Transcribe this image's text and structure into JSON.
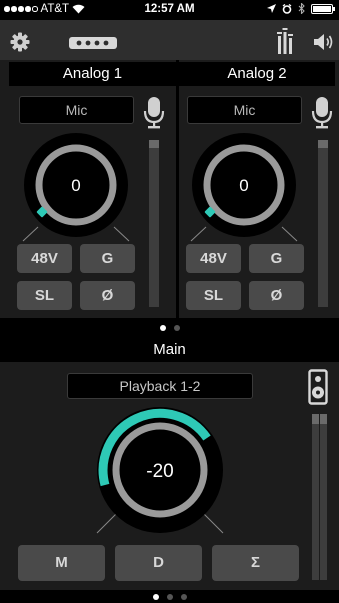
{
  "status_bar": {
    "carrier": "AT&T",
    "time": "12:57 AM"
  },
  "toolbar": {
    "settings_icon": "gear-icon",
    "device_icon": "device-connector-icon",
    "mixer_icon": "mixer-icon",
    "speaker_icon": "speaker-icon"
  },
  "channels": [
    {
      "name": "Analog 1",
      "input_type": "Mic",
      "gain": "0",
      "buttons": {
        "phantom": "48V",
        "group": "G",
        "stereo_link": "SL",
        "phase": "Ø"
      }
    },
    {
      "name": "Analog 2",
      "input_type": "Mic",
      "gain": "0",
      "buttons": {
        "phantom": "48V",
        "group": "G",
        "stereo_link": "SL",
        "phase": "Ø"
      }
    }
  ],
  "channel_page": {
    "total": 2,
    "active": 1
  },
  "main": {
    "title": "Main",
    "source": "Playback 1-2",
    "level": "-20",
    "buttons": {
      "mute": "M",
      "dim": "D",
      "sum": "Σ"
    }
  },
  "main_page": {
    "total": 3,
    "active": 1
  },
  "colors": {
    "accent": "#2ec9b6",
    "knob_ring": "#9a9a9a",
    "panel": "#1c1c1c",
    "button": "#4a4a4a"
  }
}
